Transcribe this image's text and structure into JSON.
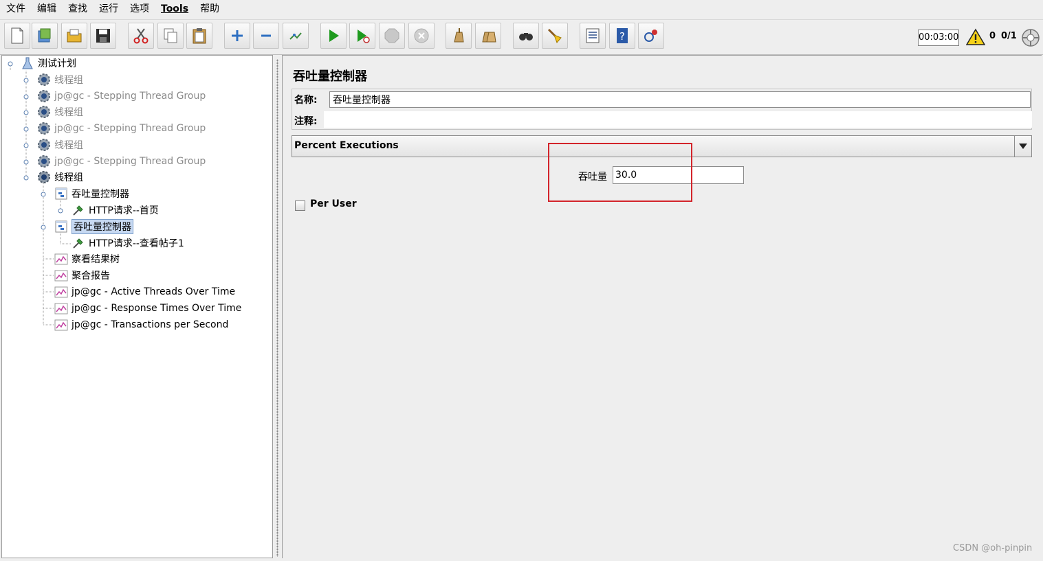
{
  "menu": [
    "文件",
    "编辑",
    "查找",
    "运行",
    "选项",
    "Tools",
    "帮助"
  ],
  "toolbar": {
    "buttons": [
      "new-icon",
      "templates-icon",
      "open-icon",
      "save-icon",
      "cut-icon",
      "copy-icon",
      "paste-icon",
      "expand-icon",
      "collapse-icon",
      "toggle-icon",
      "start-icon",
      "start-no-pause-icon",
      "stop-icon",
      "shutdown-icon",
      "clear-icon",
      "clear-all-icon",
      "search-icon",
      "reset-search-icon",
      "function-helper-icon",
      "help-icon",
      "remote-icon"
    ],
    "timer": "00:03:00",
    "error_count": "0",
    "threads": "0/1"
  },
  "tree": [
    {
      "label": "测试计划",
      "icon": "test-plan-icon",
      "disabled": false
    },
    {
      "label": "线程组",
      "icon": "gear-icon",
      "disabled": true
    },
    {
      "label": "jp@gc - Stepping Thread Group",
      "icon": "gear-icon",
      "disabled": true
    },
    {
      "label": "线程组",
      "icon": "gear-icon",
      "disabled": true
    },
    {
      "label": "jp@gc - Stepping Thread Group",
      "icon": "gear-icon",
      "disabled": true
    },
    {
      "label": "线程组",
      "icon": "gear-icon",
      "disabled": true
    },
    {
      "label": "jp@gc - Stepping Thread Group",
      "icon": "gear-icon",
      "disabled": true
    },
    {
      "label": "线程组",
      "icon": "gear-icon",
      "disabled": false
    },
    {
      "label": "吞吐量控制器",
      "icon": "controller-icon",
      "disabled": false
    },
    {
      "label": "HTTP请求--首页",
      "icon": "sampler-icon",
      "disabled": false
    },
    {
      "label": "吞吐量控制器",
      "icon": "controller-icon",
      "disabled": false,
      "selected": true
    },
    {
      "label": "HTTP请求--查看帖子1",
      "icon": "sampler-icon",
      "disabled": false
    },
    {
      "label": "察看结果树",
      "icon": "listener-icon",
      "disabled": false
    },
    {
      "label": "聚合报告",
      "icon": "listener-icon",
      "disabled": false
    },
    {
      "label": "jp@gc - Active Threads Over Time",
      "icon": "listener-icon",
      "disabled": false
    },
    {
      "label": "jp@gc - Response Times Over Time",
      "icon": "listener-icon",
      "disabled": false
    },
    {
      "label": "jp@gc - Transactions per Second",
      "icon": "listener-icon",
      "disabled": false
    }
  ],
  "panel": {
    "title": "吞吐量控制器",
    "name_label": "名称:",
    "name_value": "吞吐量控制器",
    "comment_label": "注释:",
    "comment_value": "",
    "mode_value": "Percent Executions",
    "throughput_label": "吞吐量",
    "throughput_value": "30.0",
    "per_user_label": "Per User",
    "per_user_checked": false
  },
  "watermark": "CSDN @oh-pinpin",
  "colors": {
    "highlight": "#d3242b",
    "selection": "#c7d9f2",
    "play": "#1e9a1e"
  }
}
